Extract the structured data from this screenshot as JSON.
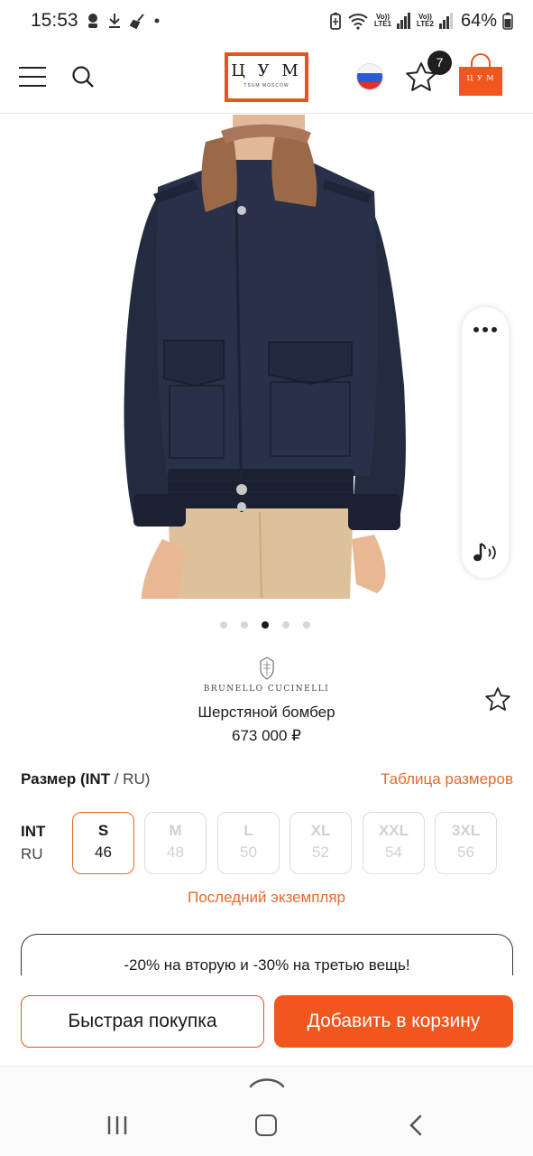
{
  "status_bar": {
    "time": "15:53",
    "battery": "64%",
    "sim1": "Vo)) LTE1",
    "sim2": "Vo)) LTE2"
  },
  "header": {
    "logo_letters": "Ц У М",
    "logo_sub": "TSUM MOSCOW",
    "favorites_count": "7",
    "bag_logo": "Ц У М"
  },
  "gallery": {
    "total_slides": 5,
    "active_slide": 3
  },
  "product": {
    "brand": "BRUNELLO CUCINELLI",
    "title": "Шерстяной бомбер",
    "price": "673 000 ₽"
  },
  "size": {
    "heading_bold": "Размер (INT",
    "heading_rest": " / RU)",
    "size_table_link": "Таблица размеров",
    "row_label_int": "INT",
    "row_label_ru": "RU",
    "options": [
      {
        "int": "S",
        "ru": "46",
        "state": "selected"
      },
      {
        "int": "M",
        "ru": "48",
        "state": "unavailable"
      },
      {
        "int": "L",
        "ru": "50",
        "state": "unavailable"
      },
      {
        "int": "XL",
        "ru": "52",
        "state": "unavailable"
      },
      {
        "int": "XXL",
        "ru": "54",
        "state": "unavailable"
      },
      {
        "int": "3XL",
        "ru": "56",
        "state": "unavailable"
      }
    ],
    "availability_note": "Последний экземпляр"
  },
  "promo": {
    "text": "-20% на вторую и -30% на третью вещь!"
  },
  "actions": {
    "quick_buy": "Быстрая покупка",
    "add_to_cart": "Добавить в корзину"
  },
  "colors": {
    "accent": "#F0561D",
    "link": "#E26A2C"
  }
}
